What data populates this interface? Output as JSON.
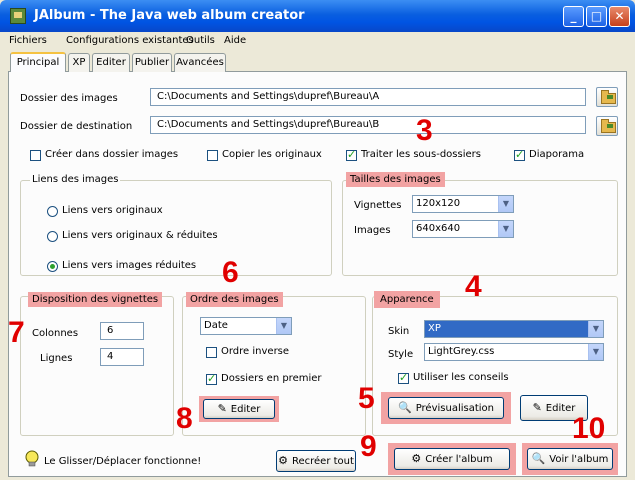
{
  "window": {
    "title": "JAlbum - The Java web album creator"
  },
  "menu": [
    "Fichiers",
    "Configurations existantes",
    "Outils",
    "Aide"
  ],
  "tabs": [
    "Principal",
    "XP",
    "Editer",
    "Publier",
    "Avancées"
  ],
  "paths": {
    "source_label": "Dossier des images",
    "source_value": "C:\\Documents and Settings\\dupref\\Bureau\\A",
    "dest_label": "Dossier de destination",
    "dest_value": "C:\\Documents and Settings\\dupref\\Bureau\\B"
  },
  "options": {
    "create_in_images": {
      "label": "Créer dans dossier images",
      "checked": false
    },
    "copy_originals": {
      "label": "Copier les originaux",
      "checked": false
    },
    "process_subfolders": {
      "label": "Traiter les sous-dossiers",
      "checked": true
    },
    "slideshow": {
      "label": "Diaporama",
      "checked": true
    }
  },
  "image_links": {
    "title": "Liens des images",
    "items": [
      "Liens vers originaux",
      "Liens vers originaux & réduites",
      "Liens vers images réduites"
    ],
    "selected": 2
  },
  "image_sizes": {
    "title": "Tailles des images",
    "thumb_label": "Vignettes",
    "thumb_value": "120x120",
    "image_label": "Images",
    "image_value": "640x640"
  },
  "layout": {
    "title": "Disposition des vignettes",
    "columns_label": "Colonnes",
    "columns_value": "6",
    "rows_label": "Lignes",
    "rows_value": "4"
  },
  "order": {
    "title": "Ordre des images",
    "sort_value": "Date",
    "reverse_label": "Ordre inverse",
    "reverse_checked": false,
    "folders_first_label": "Dossiers en premier",
    "folders_first_checked": true,
    "edit_label": "Editer"
  },
  "appearance": {
    "title": "Apparence",
    "skin_label": "Skin",
    "skin_value": "XP",
    "style_label": "Style",
    "style_value": "LightGrey.css",
    "use_hints_label": "Utiliser les conseils",
    "use_hints_checked": true,
    "preview_label": "Prévisualisation",
    "edit_label": "Editer"
  },
  "bottom": {
    "hint": "Le Glisser/Déplacer fonctionne!",
    "recreate_label": "Recréer tout",
    "create_label": "Créer l'album",
    "view_label": "Voir l'album"
  },
  "annotations": [
    "3",
    "4",
    "5",
    "6",
    "7",
    "8",
    "9",
    "10"
  ],
  "colors": {
    "titlebar": "#0054e3",
    "highlight": "#f2a3a3",
    "annotation": "#e00000"
  }
}
